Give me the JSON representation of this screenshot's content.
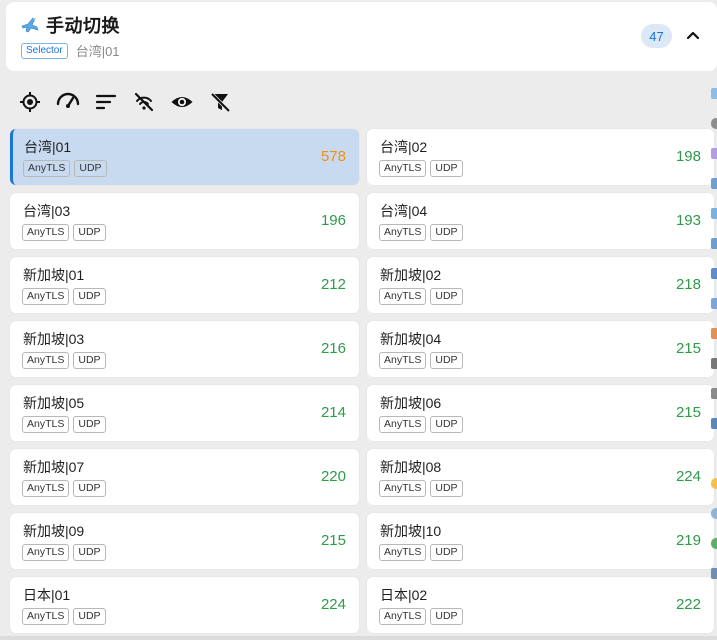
{
  "group": {
    "title": "手动切换",
    "type_badge": "Selector",
    "current_node": "台湾|01",
    "node_count": "47",
    "icon": "airplane-icon",
    "collapse_icon": "chevron-up-icon"
  },
  "toolbar": {
    "tools": [
      {
        "name": "locate-icon"
      },
      {
        "name": "speed-test-icon"
      },
      {
        "name": "sort-icon"
      },
      {
        "name": "hide-unavailable-icon"
      },
      {
        "name": "show-icon"
      },
      {
        "name": "filter-clear-icon"
      }
    ]
  },
  "proxies": [
    {
      "name": "台湾|01",
      "protocol": "AnyTLS",
      "udp": "UDP",
      "delay": "578",
      "selected": true
    },
    {
      "name": "台湾|02",
      "protocol": "AnyTLS",
      "udp": "UDP",
      "delay": "198"
    },
    {
      "name": "台湾|03",
      "protocol": "AnyTLS",
      "udp": "UDP",
      "delay": "196"
    },
    {
      "name": "台湾|04",
      "protocol": "AnyTLS",
      "udp": "UDP",
      "delay": "193"
    },
    {
      "name": "新加坡|01",
      "protocol": "AnyTLS",
      "udp": "UDP",
      "delay": "212"
    },
    {
      "name": "新加坡|02",
      "protocol": "AnyTLS",
      "udp": "UDP",
      "delay": "218"
    },
    {
      "name": "新加坡|03",
      "protocol": "AnyTLS",
      "udp": "UDP",
      "delay": "216"
    },
    {
      "name": "新加坡|04",
      "protocol": "AnyTLS",
      "udp": "UDP",
      "delay": "215"
    },
    {
      "name": "新加坡|05",
      "protocol": "AnyTLS",
      "udp": "UDP",
      "delay": "214"
    },
    {
      "name": "新加坡|06",
      "protocol": "AnyTLS",
      "udp": "UDP",
      "delay": "215"
    },
    {
      "name": "新加坡|07",
      "protocol": "AnyTLS",
      "udp": "UDP",
      "delay": "220"
    },
    {
      "name": "新加坡|08",
      "protocol": "AnyTLS",
      "udp": "UDP",
      "delay": "224"
    },
    {
      "name": "新加坡|09",
      "protocol": "AnyTLS",
      "udp": "UDP",
      "delay": "215"
    },
    {
      "name": "新加坡|10",
      "protocol": "AnyTLS",
      "udp": "UDP",
      "delay": "219"
    },
    {
      "name": "日本|01",
      "protocol": "AnyTLS",
      "udp": "UDP",
      "delay": "224"
    },
    {
      "name": "日本|02",
      "protocol": "AnyTLS",
      "udp": "UDP",
      "delay": "222"
    }
  ],
  "colors": {
    "accent": "#1976d2",
    "delay_good": "#2e9a4a",
    "delay_warn": "#f0900f",
    "selected_bg": "#c8daef"
  }
}
